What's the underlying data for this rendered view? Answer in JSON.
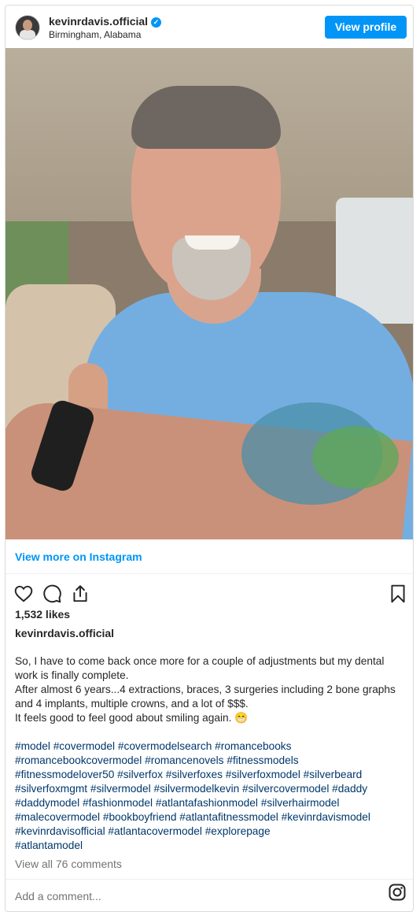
{
  "header": {
    "username": "kevinrdavis.official",
    "verified_icon": "verified-badge-icon",
    "location": "Birmingham, Alabama",
    "view_profile_label": "View profile"
  },
  "post": {
    "image_alt": "",
    "view_more_label": "View more on Instagram",
    "icons": [
      "heart-icon",
      "comment-icon",
      "share-icon",
      "bookmark-icon"
    ],
    "likes": "1,532 likes",
    "owner": "kevinrdavis.official",
    "caption": {
      "line1": "So, I have to come back once more for a couple of adjustments but my dental work is finally complete.",
      "line2": "After almost 6 years...4 extractions, braces, 3 surgeries including 2 bone graphs and 4 implants, multiple crowns, and a lot of $$$.",
      "line3": "It feels good to feel good about smiling again. 😁",
      "hashtags": [
        "#model #covermodel #covermodelsearch #romancebooks",
        "#romancebookcovermodel #romancenovels #fitnessmodels",
        "#fitnessmodelover50 #silverfox #silverfoxes #silverfoxmodel #silverbeard",
        "#silverfoxmgmt #silvermodel #silvermodelkevin #silvercovermodel #daddy",
        "#daddymodel #fashionmodel #atlantafashionmodel #silverhairmodel",
        "#malecovermodel #bookboyfriend #atlantafitnessmodel #kevinrdavismodel",
        "#kevinrdavisofficial #atlantacovermodel #explorepage",
        "#atlantamodel"
      ]
    },
    "view_comments": "View all 76 comments",
    "add_comment_placeholder": "Add a comment...",
    "instagram_icon": "instagram-logo-icon"
  },
  "colors": {
    "accent": "#0095f6",
    "hashtag": "#00376b",
    "muted": "#737373",
    "text": "#262626"
  }
}
